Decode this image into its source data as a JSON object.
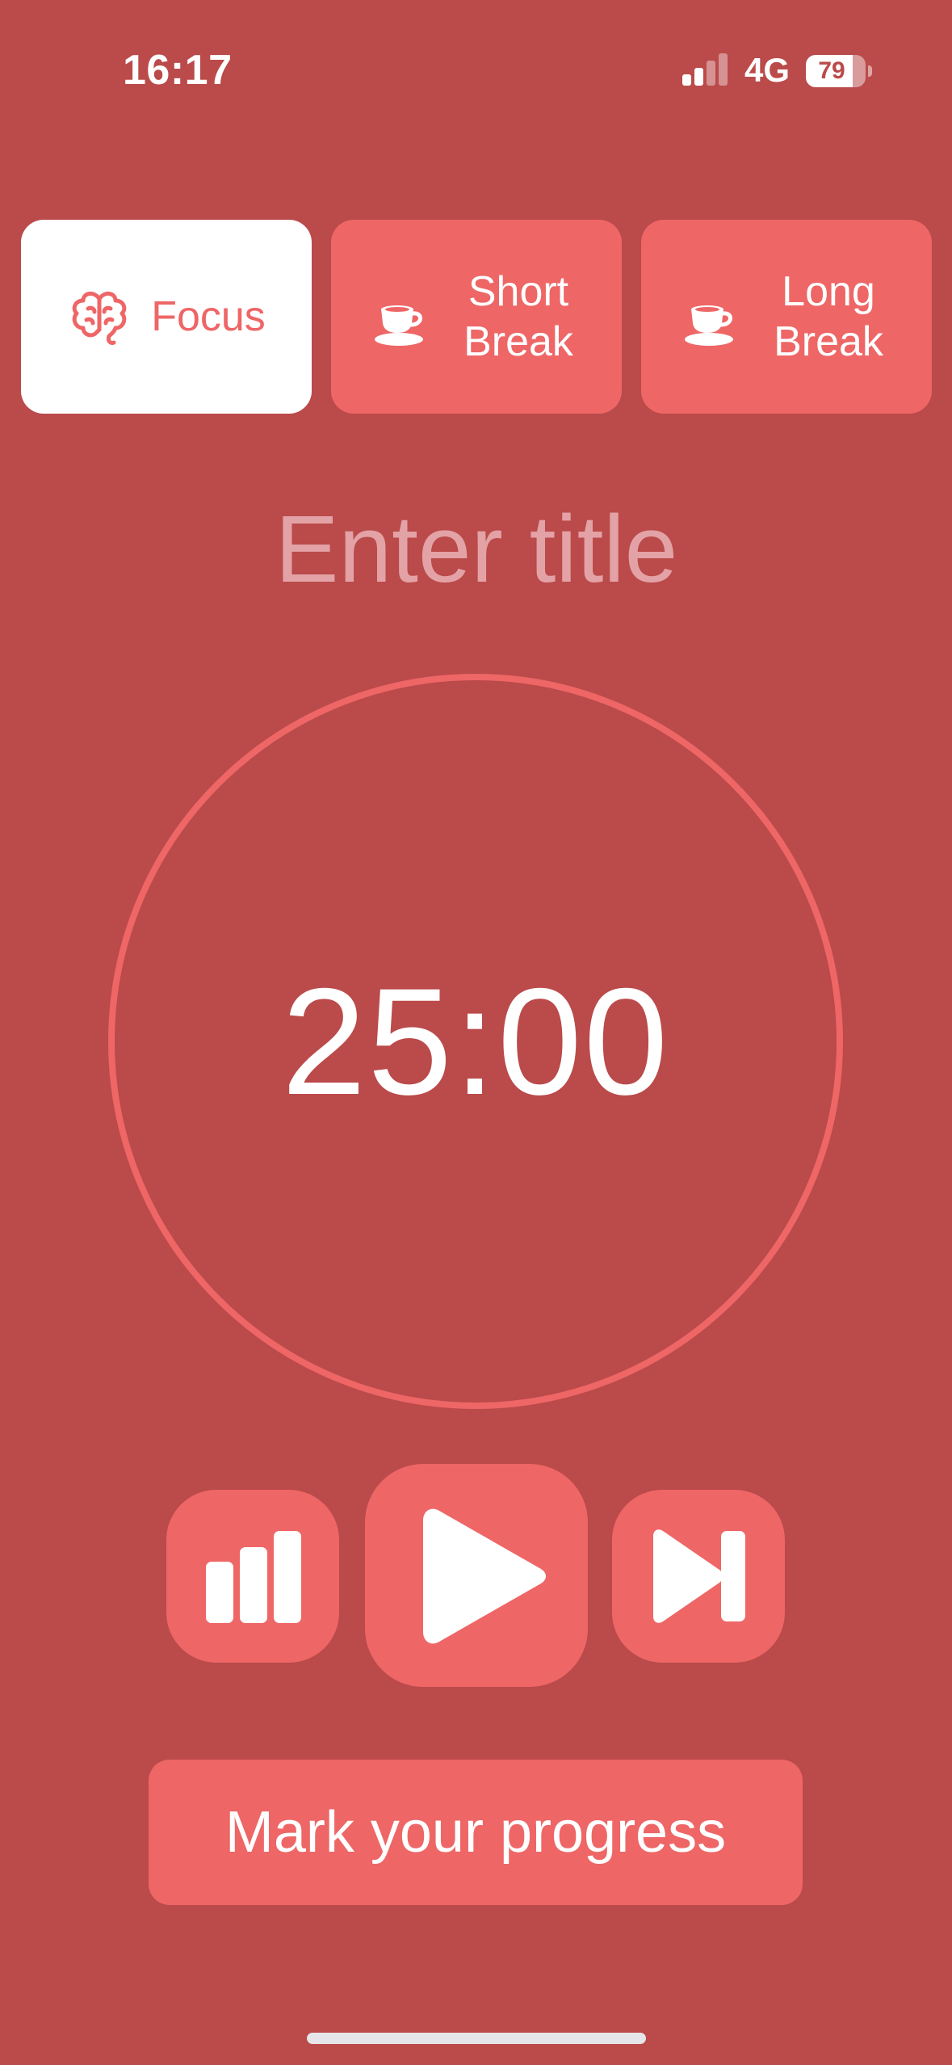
{
  "status_bar": {
    "time": "16:17",
    "network": "4G",
    "battery": "79",
    "battery_level": 0.79,
    "signal_bars_active": 2,
    "signal_bars_total": 4
  },
  "tabs": [
    {
      "label": "Focus",
      "icon": "brain-icon",
      "active": true
    },
    {
      "label": "Short\nBreak",
      "icon": "coffee-cup-icon",
      "active": false
    },
    {
      "label": "Long\nBreak",
      "icon": "coffee-cup-icon",
      "active": false
    }
  ],
  "title_input": {
    "placeholder": "Enter title",
    "value": ""
  },
  "timer": {
    "display": "25:00"
  },
  "controls": {
    "stats_icon": "bar-chart-icon",
    "play_icon": "play-icon",
    "skip_icon": "skip-forward-icon"
  },
  "mark_progress_label": "Mark your progress",
  "colors": {
    "background": "#BB4A4A",
    "accent": "#EE6666",
    "placeholder": "#E3A2A6",
    "white": "#FFFFFF"
  }
}
